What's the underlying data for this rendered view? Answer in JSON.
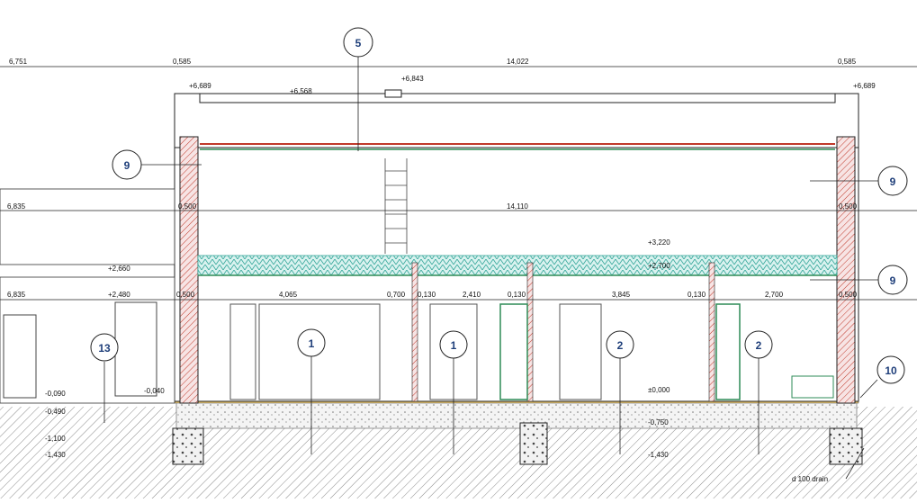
{
  "top_dims": [
    "6,751",
    "0,585",
    "14,022",
    "0,585"
  ],
  "upper_dims": [
    "6,835",
    "0,500",
    "14,110",
    "0,500"
  ],
  "lower_dims": [
    "6,835",
    "0,500",
    "4,065",
    "0,700",
    "0,130",
    "2,410",
    "0,130",
    "3,845",
    "0,130",
    "2,700",
    "0,500"
  ],
  "levels": {
    "left_parapet": "+6,689",
    "right_parapet": "+6,689",
    "roof_mid": "+6,568",
    "ridge": "+6,843",
    "ceiling": "+3,220",
    "floor_upper": "+2,700",
    "annex_top": "+2,660",
    "annex_eave": "+2,480",
    "ground_floor": "±0,000",
    "foundation": "-0,750",
    "footing": "-1,430",
    "left_090": "-0,090",
    "left_040": "-0,040",
    "left_490": "-0,490",
    "left_1100": "-1,100",
    "left_1430": "-1,430"
  },
  "tags": {
    "t5": "5",
    "t9a": "9",
    "t9b": "9",
    "t9c": "9",
    "t1a": "1",
    "t1b": "1",
    "t2a": "2",
    "t2b": "2",
    "t10": "10",
    "t13": "13"
  },
  "drain_label": "d 100 drain"
}
